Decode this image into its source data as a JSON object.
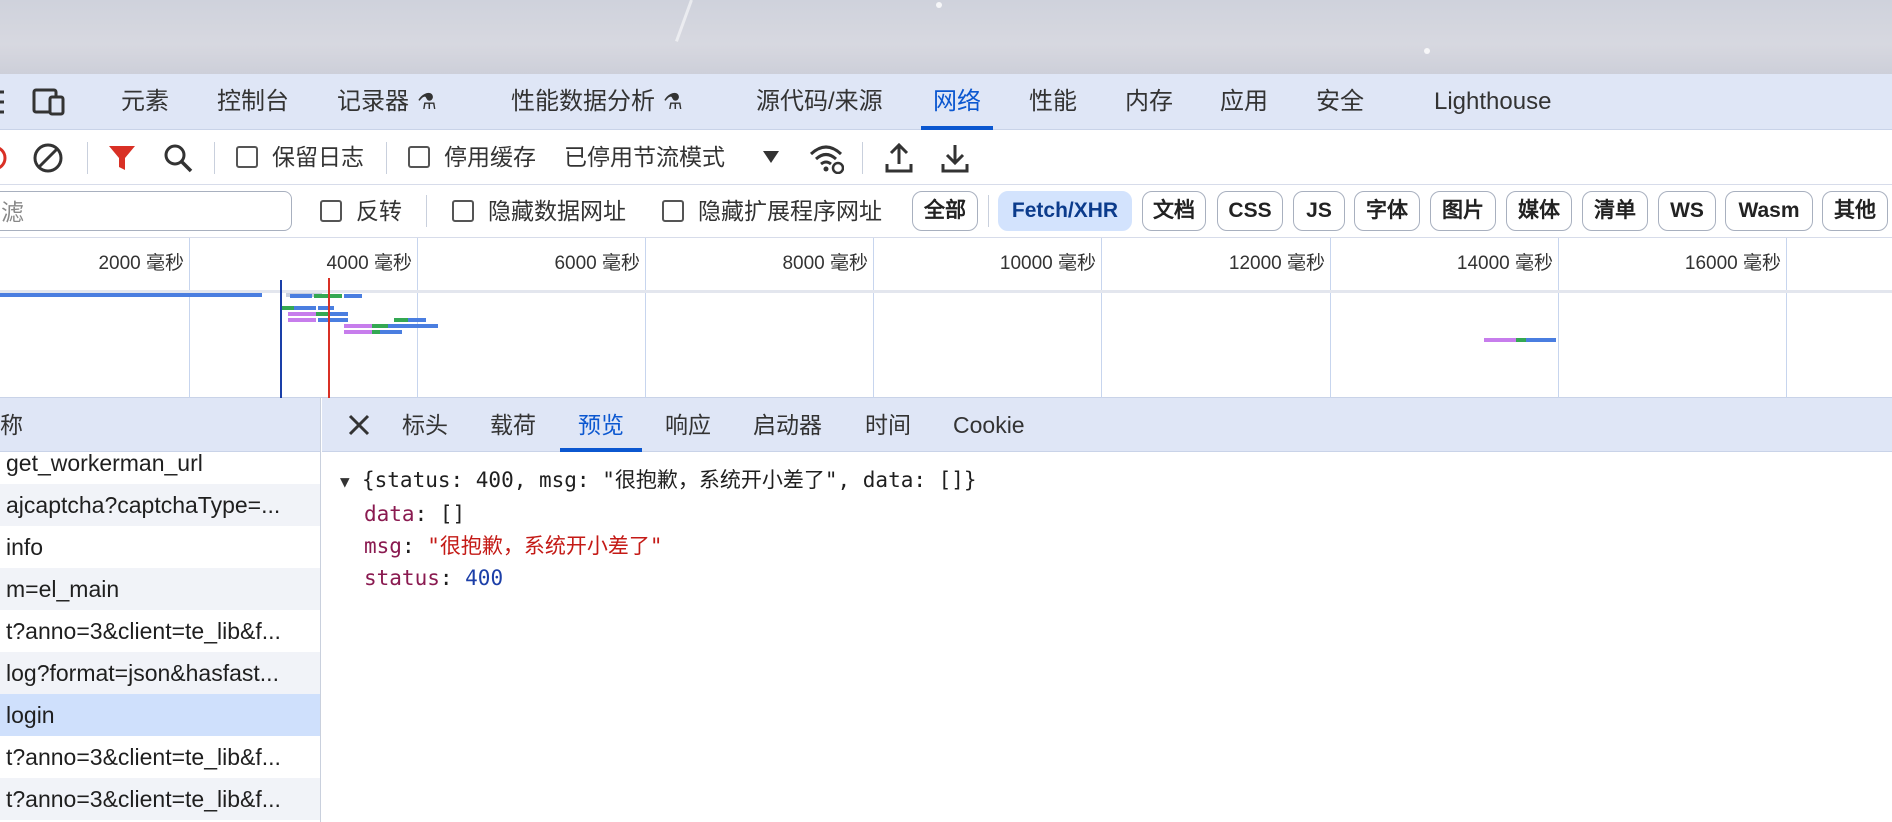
{
  "tabs": [
    {
      "label": "元素",
      "active": false,
      "experimental": false
    },
    {
      "label": "控制台",
      "active": false,
      "experimental": false
    },
    {
      "label": "记录器",
      "active": false,
      "experimental": true
    },
    {
      "label": "性能数据分析",
      "active": false,
      "experimental": true
    },
    {
      "label": "源代码/来源",
      "active": false,
      "experimental": false
    },
    {
      "label": "网络",
      "active": true,
      "experimental": false
    },
    {
      "label": "性能",
      "active": false,
      "experimental": false
    },
    {
      "label": "内存",
      "active": false,
      "experimental": false
    },
    {
      "label": "应用",
      "active": false,
      "experimental": false
    },
    {
      "label": "安全",
      "active": false,
      "experimental": false
    },
    {
      "label": "Lighthouse",
      "active": false,
      "experimental": false
    }
  ],
  "toolbar": {
    "preserve_log": {
      "label": "保留日志",
      "checked": false
    },
    "disable_cache": {
      "label": "停用缓存",
      "checked": false
    },
    "throttling": "已停用节流模式"
  },
  "filter": {
    "placeholder": "滤",
    "invert": {
      "label": "反转",
      "checked": false
    },
    "hide_data_urls": {
      "label": "隐藏数据网址",
      "checked": false
    },
    "hide_extension_urls": {
      "label": "隐藏扩展程序网址",
      "checked": false
    },
    "types": [
      {
        "label": "全部",
        "active": false
      },
      {
        "label": "Fetch/XHR",
        "active": true
      },
      {
        "label": "文档",
        "active": false
      },
      {
        "label": "CSS",
        "active": false
      },
      {
        "label": "JS",
        "active": false
      },
      {
        "label": "字体",
        "active": false
      },
      {
        "label": "图片",
        "active": false
      },
      {
        "label": "媒体",
        "active": false
      },
      {
        "label": "清单",
        "active": false
      },
      {
        "label": "WS",
        "active": false
      },
      {
        "label": "Wasm",
        "active": false
      },
      {
        "label": "其他",
        "active": false
      }
    ]
  },
  "timeline": {
    "ticks": [
      "2000 毫秒",
      "4000 毫秒",
      "6000 毫秒",
      "8000 毫秒",
      "10000 毫秒",
      "12000 毫秒",
      "14000 毫秒",
      "16000 毫秒"
    ]
  },
  "requests": {
    "header": "称",
    "rows": [
      {
        "name": "get_workerman_url",
        "selected": false
      },
      {
        "name": "ajcaptcha?captchaType=...",
        "selected": false
      },
      {
        "name": "info",
        "selected": false
      },
      {
        "name": "m=el_main",
        "selected": false
      },
      {
        "name": "t?anno=3&client=te_lib&f...",
        "selected": false
      },
      {
        "name": "log?format=json&hasfast...",
        "selected": false
      },
      {
        "name": "login",
        "selected": true
      },
      {
        "name": "t?anno=3&client=te_lib&f...",
        "selected": false
      },
      {
        "name": "t?anno=3&client=te_lib&f...",
        "selected": false
      }
    ]
  },
  "detail": {
    "tabs": [
      {
        "label": "标头",
        "active": false
      },
      {
        "label": "载荷",
        "active": false
      },
      {
        "label": "预览",
        "active": true
      },
      {
        "label": "响应",
        "active": false
      },
      {
        "label": "启动器",
        "active": false
      },
      {
        "label": "时间",
        "active": false
      },
      {
        "label": "Cookie",
        "active": false
      }
    ],
    "preview": {
      "summary": "{status: 400, msg: \"很抱歉，系统开小差了\", data: []}",
      "fields": [
        {
          "key": "data",
          "value": "[]",
          "kind": "plain"
        },
        {
          "key": "msg",
          "value": "\"很抱歉，系统开小差了\"",
          "kind": "string"
        },
        {
          "key": "status",
          "value": "400",
          "kind": "number"
        }
      ]
    }
  },
  "colors": {
    "accent": "#0b57d0",
    "bar_blue": "#4a7ee0",
    "bar_green": "#34a853",
    "bar_purple": "#c77dec",
    "marker_red": "#d93025",
    "marker_blue": "#1a3fa8"
  }
}
